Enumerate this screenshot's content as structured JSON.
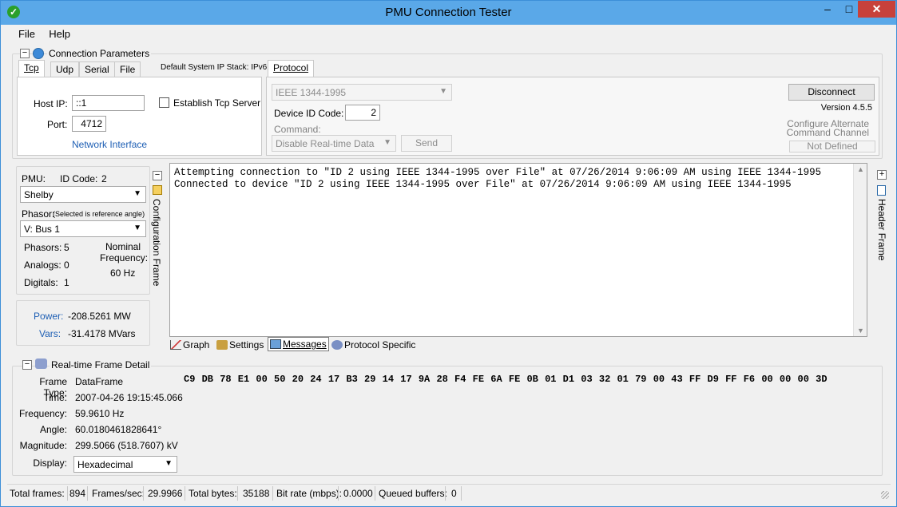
{
  "window": {
    "title": "PMU Connection Tester",
    "minimize": "–",
    "maximize": "□",
    "close": "✕"
  },
  "menu": [
    "File",
    "Help"
  ],
  "connection": {
    "group_title": "Connection Parameters",
    "tabs": [
      "Tcp",
      "Udp",
      "Serial",
      "File"
    ],
    "default_ip_stack": "Default System IP Stack: IPv6",
    "host_ip_label": "Host IP:",
    "host_ip_value": "::1",
    "port_label": "Port:",
    "port_value": "4712",
    "establish_server_label": "Establish Tcp Server",
    "network_interface_link": "Network Interface"
  },
  "protocol": {
    "tab": "Protocol",
    "protocol_value": "IEEE 1344-1995",
    "device_id_label": "Device ID Code:",
    "device_id_value": "2",
    "command_label": "Command:",
    "command_value": "Disable Real-time Data",
    "send_button": "Send",
    "disconnect_button": "Disconnect",
    "version": "Version 4.5.5",
    "configure_alternate": "Configure Alternate",
    "command_channel": "Command Channel",
    "not_defined_button": "Not Defined"
  },
  "config": {
    "pmu_label": "PMU:",
    "id_code_label": "ID Code:",
    "id_code_value": "2",
    "pmu_value": "Shelby",
    "phasor_label": "Phasor:",
    "phasor_note": "(Selected is reference angle)",
    "phasor_value": "V: Bus 1",
    "phasors_label": "Phasors:",
    "phasors_value": "5",
    "analogs_label": "Analogs:",
    "analogs_value": "0",
    "digitals_label": "Digitals:",
    "digitals_value": "1",
    "nominal_label": "Nominal",
    "frequency_label": "Frequency:",
    "frequency_value": "60 Hz",
    "side_label": "Configuration Frame"
  },
  "power": {
    "power_label": "Power:",
    "power_value": "-208.5261 MW",
    "vars_label": "Vars:",
    "vars_value": "-31.4178 MVars"
  },
  "messages": {
    "lines": [
      "Attempting connection to \"ID 2 using IEEE 1344-1995 over File\" at 07/26/2014 9:06:09 AM using IEEE 1344-1995",
      "Connected to device \"ID 2 using IEEE 1344-1995 over File\" at 07/26/2014 9:06:09 AM using IEEE 1344-1995"
    ],
    "tabs": [
      "Graph",
      "Settings",
      "Messages",
      "Protocol Specific"
    ],
    "header_frame_label": "Header Frame"
  },
  "realtime": {
    "group_title": "Real-time Frame Detail",
    "frame_type_label": "Frame Type:",
    "frame_type_value": "DataFrame",
    "time_label": "Time:",
    "time_value": "2007-04-26 19:15:45.066",
    "frequency_label": "Frequency:",
    "frequency_value": "59.9610 Hz",
    "angle_label": "Angle:",
    "angle_value": "60.0180461828641°",
    "magnitude_label": "Magnitude:",
    "magnitude_value": "299.5066 (518.7607) kV",
    "display_label": "Display:",
    "display_value": "Hexadecimal",
    "hex_data": "C9 DB 78 E1 00 50 20 24 17 B3 29 14 17 9A 28 F4 FE 6A FE 0B 01 D1 03 32 01 79 00 43 FF D9 FF F6 00 00 00 3D"
  },
  "status": {
    "total_frames_label": "Total frames:",
    "total_frames_value": "894",
    "frames_sec_label": "Frames/sec:",
    "frames_sec_value": "29.9966",
    "total_bytes_label": "Total bytes:",
    "total_bytes_value": "35188",
    "bit_rate_label": "Bit rate (mbps):",
    "bit_rate_value": "0.0000",
    "queued_label": "Queued buffers:",
    "queued_value": "0"
  }
}
